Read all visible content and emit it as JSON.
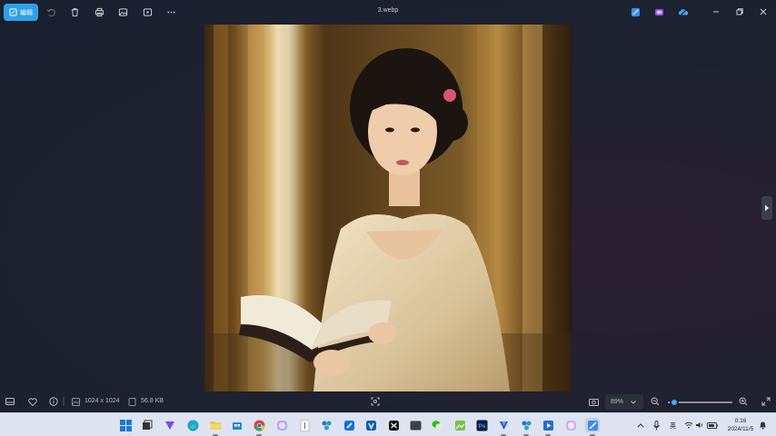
{
  "titlebar": {
    "edit_label": "编辑",
    "file_name": "3.webp"
  },
  "infobar": {
    "dimensions": "1024 x 1024",
    "file_size": "56.8 KB",
    "zoom": "89%",
    "zoom_level": 0.1
  },
  "tray": {
    "ime": "英",
    "time": "0:16",
    "date": "2024/11/5"
  },
  "colors": {
    "accent": "#2fa0e8",
    "viewer_bg": "#1d2230",
    "taskbar_bg": "#dde3f0"
  },
  "icons": {
    "toolbar": [
      "rotate-icon",
      "delete-icon",
      "print-icon",
      "gallery-icon",
      "slideshow-icon",
      "more-icon"
    ],
    "window": [
      "minimize-icon",
      "maximize-icon",
      "close-icon"
    ]
  }
}
